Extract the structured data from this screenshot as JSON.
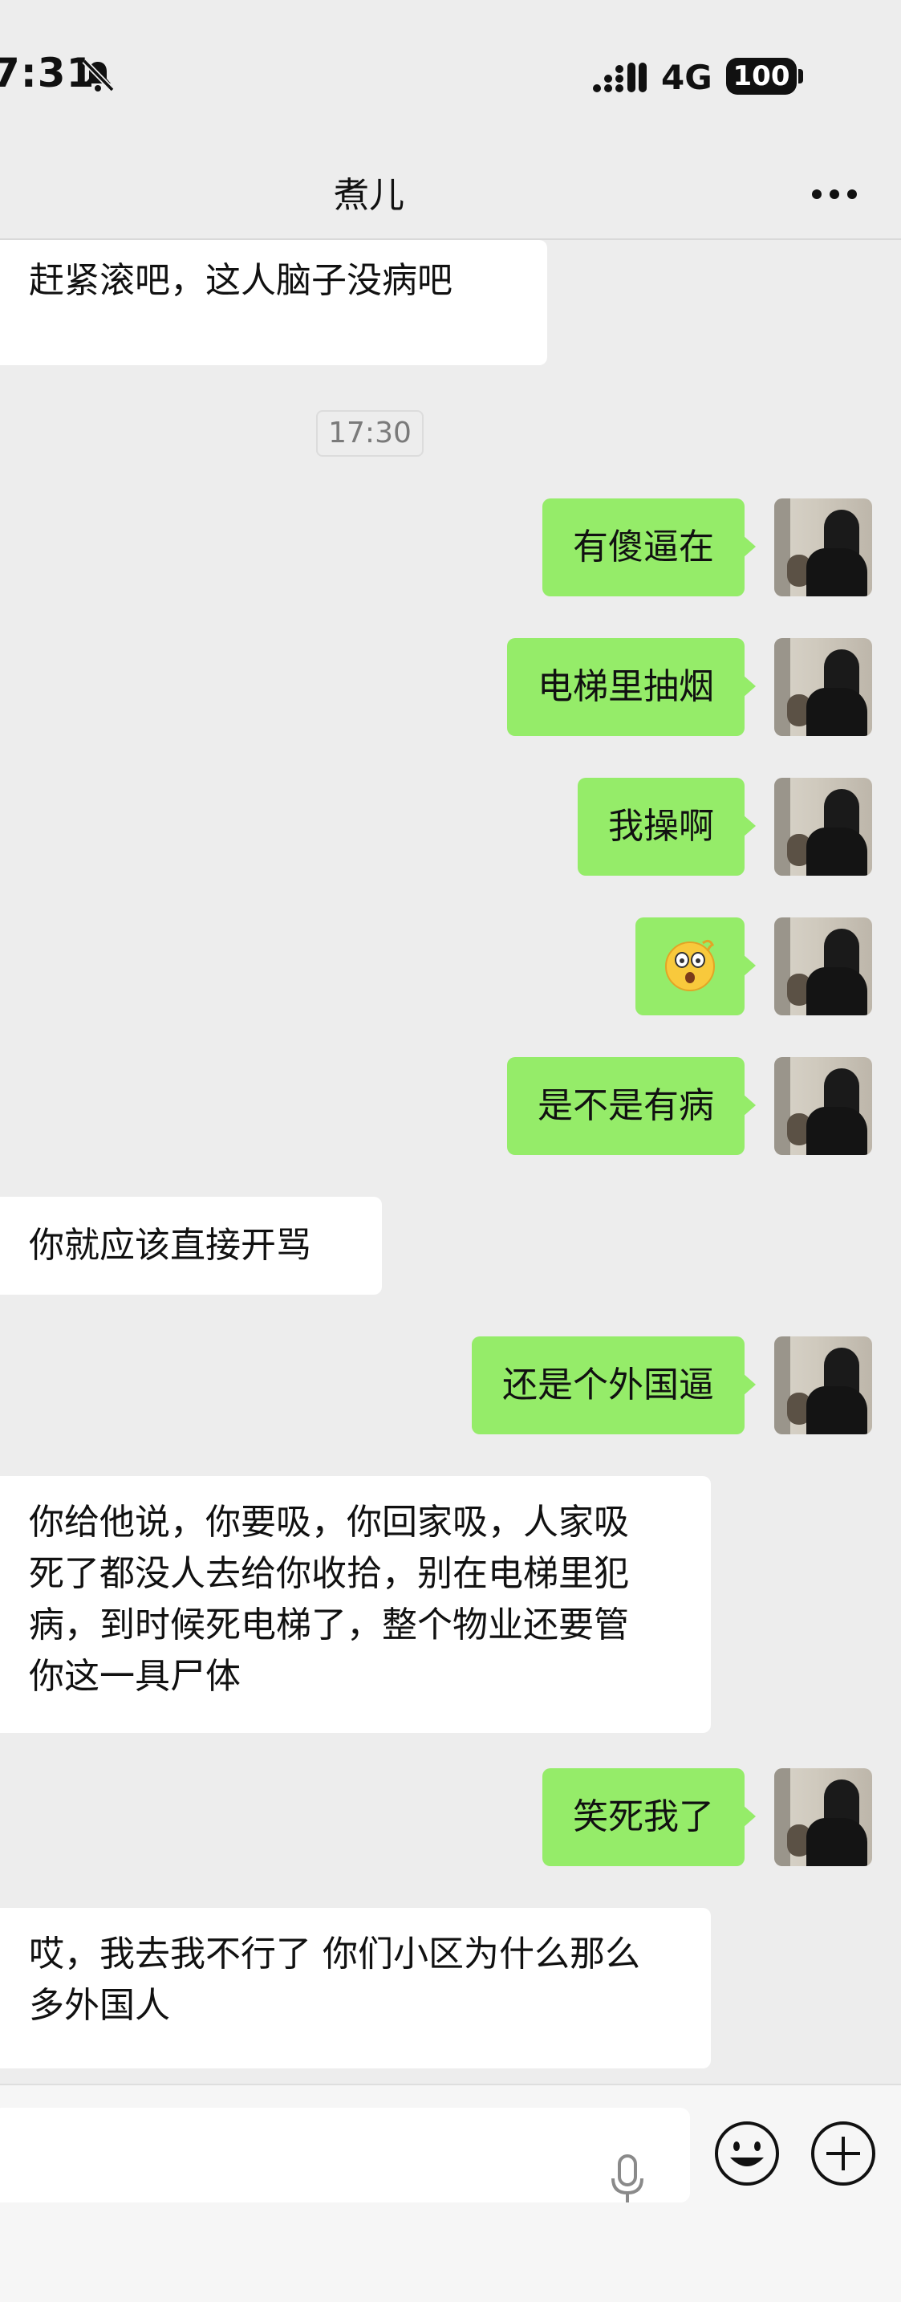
{
  "status_bar": {
    "time": "7:31",
    "network": "4G",
    "battery": "100"
  },
  "header": {
    "title": "煮儿"
  },
  "chat": {
    "time_divider": "17:30",
    "messages": [
      {
        "side": "in",
        "text": "赶紧滚吧，这人脑子没病吧"
      },
      {
        "side": "out",
        "text": "有傻逼在"
      },
      {
        "side": "out",
        "text": "电梯里抽烟"
      },
      {
        "side": "out",
        "text": "我操啊"
      },
      {
        "side": "out",
        "emoji": "shocked-face"
      },
      {
        "side": "out",
        "text": "是不是有病"
      },
      {
        "side": "in",
        "text": "你就应该直接开骂"
      },
      {
        "side": "out",
        "text": "还是个外国逼"
      },
      {
        "side": "in",
        "text": "你给他说，你要吸，你回家吸，人家吸死了都没人去给你收拾，别在电梯里犯病，到时候死电梯了，整个物业还要管你这一具尸体"
      },
      {
        "side": "out",
        "text": "笑死我了"
      },
      {
        "side": "in",
        "text": "哎，我去我不行了 你们小区为什么那么多外国人"
      }
    ]
  },
  "colors": {
    "outgoing_bubble": "#95ec69",
    "incoming_bubble": "#ffffff",
    "background": "#ededed"
  },
  "icons": [
    "bell-muted-icon",
    "signal-icon",
    "more-icon",
    "mic-icon",
    "emoji-icon",
    "plus-icon"
  ]
}
